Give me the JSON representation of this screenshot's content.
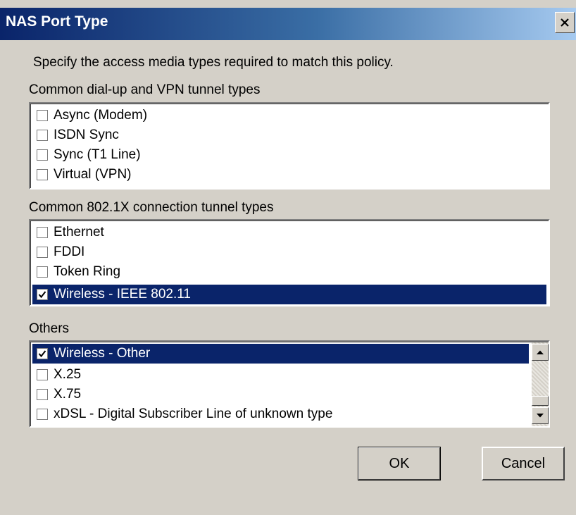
{
  "window": {
    "title": "NAS Port Type"
  },
  "instructions": "Specify the access media types required to match this policy.",
  "groups": [
    {
      "heading": "Common dial-up and VPN tunnel types",
      "items": [
        {
          "label": "Async (Modem)",
          "checked": false,
          "selected": false
        },
        {
          "label": "ISDN Sync",
          "checked": false,
          "selected": false
        },
        {
          "label": "Sync (T1 Line)",
          "checked": false,
          "selected": false
        },
        {
          "label": "Virtual (VPN)",
          "checked": false,
          "selected": false
        }
      ]
    },
    {
      "heading": "Common 802.1X connection tunnel types",
      "items": [
        {
          "label": "Ethernet",
          "checked": false,
          "selected": false
        },
        {
          "label": "FDDI",
          "checked": false,
          "selected": false
        },
        {
          "label": "Token Ring",
          "checked": false,
          "selected": false
        },
        {
          "label": "Wireless - IEEE 802.11",
          "checked": true,
          "selected": true
        }
      ]
    },
    {
      "heading": "Others",
      "items": [
        {
          "label": "Wireless - Other",
          "checked": true,
          "selected": true
        },
        {
          "label": "X.25",
          "checked": false,
          "selected": false
        },
        {
          "label": "X.75",
          "checked": false,
          "selected": false
        },
        {
          "label": "xDSL - Digital Subscriber Line of unknown type",
          "checked": false,
          "selected": false
        }
      ]
    }
  ],
  "buttons": {
    "ok": "OK",
    "cancel": "Cancel"
  },
  "colors": {
    "selection": "#0a246a",
    "face": "#d4d0c8",
    "titlebar": "#0a246a"
  },
  "icons": {
    "close": "close-icon",
    "check": "check-icon",
    "scroll_up": "arrow-up-icon",
    "scroll_down": "arrow-down-icon"
  }
}
